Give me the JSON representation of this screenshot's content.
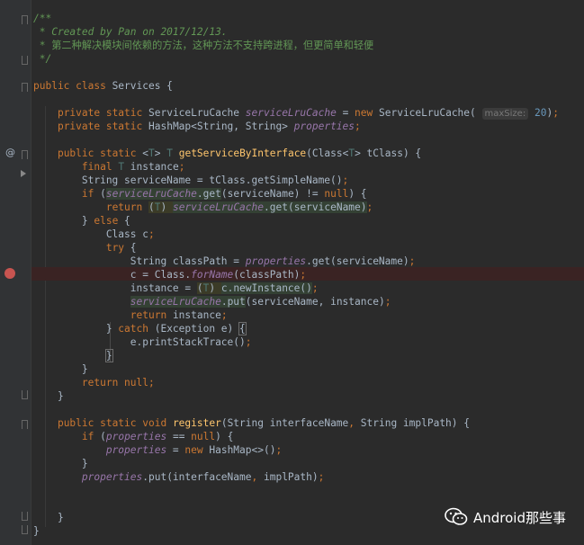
{
  "editor": {
    "lines": [
      [
        {
          "t": "/**",
          "c": "cm"
        }
      ],
      [
        {
          "t": " * Created by Pan on 2017/12/13.",
          "c": "cm"
        }
      ],
      [
        {
          "t": " * 第二种解决模块间依赖的方法，这种方法不支持跨进程，但更简单和轻便",
          "c": "cmcn"
        }
      ],
      [
        {
          "t": " */",
          "c": "cm"
        }
      ],
      [],
      [
        {
          "t": "public class ",
          "c": "kw"
        },
        {
          "t": "Services {"
        }
      ],
      [],
      [
        {
          "t": "    "
        },
        {
          "t": "private static ",
          "c": "kw"
        },
        {
          "t": "ServiceLruCache "
        },
        {
          "t": "serviceLruCache",
          "c": "fld"
        },
        {
          "t": " = "
        },
        {
          "t": "new ",
          "c": "kw"
        },
        {
          "t": "ServiceLruCache( "
        },
        {
          "t": "maxSize:",
          "c": "hint"
        },
        {
          "t": " "
        },
        {
          "t": "20",
          "c": "num"
        },
        {
          "t": ")"
        },
        {
          "t": ";",
          "c": "kw"
        }
      ],
      [
        {
          "t": "    "
        },
        {
          "t": "private static ",
          "c": "kw"
        },
        {
          "t": "HashMap<String, String> "
        },
        {
          "t": "properties",
          "c": "fld"
        },
        {
          "t": ";",
          "c": "kw"
        }
      ],
      [],
      [
        {
          "t": "    "
        },
        {
          "t": "public static ",
          "c": "kw"
        },
        {
          "t": "<"
        },
        {
          "t": "T",
          "c": "tp"
        },
        {
          "t": "> "
        },
        {
          "t": "T ",
          "c": "tp"
        },
        {
          "t": "getServiceByInterface",
          "c": "fn"
        },
        {
          "t": "(Class<"
        },
        {
          "t": "T",
          "c": "tp"
        },
        {
          "t": "> tClass) {"
        }
      ],
      [
        {
          "t": "        "
        },
        {
          "t": "final ",
          "c": "kw"
        },
        {
          "t": "T ",
          "c": "tp"
        },
        {
          "t": "instance"
        },
        {
          "t": ";",
          "c": "kw"
        }
      ],
      [
        {
          "t": "        String serviceName = tClass.getSimpleName()"
        },
        {
          "t": ";",
          "c": "kw"
        }
      ],
      [
        {
          "t": "        "
        },
        {
          "t": "if ",
          "c": "kw"
        },
        {
          "t": "("
        },
        {
          "t": "serviceLruCache",
          "c": "fld hl"
        },
        {
          "t": ".get",
          "c": "hl"
        },
        {
          "t": "(serviceName) != "
        },
        {
          "t": "null",
          "c": "kw"
        },
        {
          "t": ") {"
        }
      ],
      [
        {
          "t": "            "
        },
        {
          "t": "return ",
          "c": "kw"
        },
        {
          "t": "(",
          "c": "hlb"
        },
        {
          "t": "T",
          "c": "tp hlb"
        },
        {
          "t": ") ",
          "c": "hlb"
        },
        {
          "t": "serviceLruCache",
          "c": "fld hl"
        },
        {
          "t": ".get(serviceName)",
          "c": "hl"
        },
        {
          "t": ";",
          "c": "kw"
        }
      ],
      [
        {
          "t": "        } "
        },
        {
          "t": "else ",
          "c": "kw"
        },
        {
          "t": "{"
        }
      ],
      [
        {
          "t": "            Class c"
        },
        {
          "t": ";",
          "c": "kw"
        }
      ],
      [
        {
          "t": "            "
        },
        {
          "t": "try ",
          "c": "kw"
        },
        {
          "t": "{"
        }
      ],
      [
        {
          "t": "                String classPath = "
        },
        {
          "t": "properties",
          "c": "fld"
        },
        {
          "t": ".get(serviceName)"
        },
        {
          "t": ";",
          "c": "kw"
        }
      ],
      [
        {
          "t": "                c = Class."
        },
        {
          "t": "forName",
          "c": "fld"
        },
        {
          "t": "(classPath)"
        },
        {
          "t": ";",
          "c": "kw"
        }
      ],
      [
        {
          "t": "                instance = "
        },
        {
          "t": "(",
          "c": "hlb"
        },
        {
          "t": "T",
          "c": "tp hlb"
        },
        {
          "t": ") ",
          "c": "hlb"
        },
        {
          "t": "c.newInstance()",
          "c": "hl"
        },
        {
          "t": ";",
          "c": "kw"
        }
      ],
      [
        {
          "t": "                "
        },
        {
          "t": "serviceLruCache",
          "c": "fld hl"
        },
        {
          "t": ".put",
          "c": "hl"
        },
        {
          "t": "(serviceName, instance)"
        },
        {
          "t": ";",
          "c": "kw"
        }
      ],
      [
        {
          "t": "                "
        },
        {
          "t": "return ",
          "c": "kw"
        },
        {
          "t": "instance"
        },
        {
          "t": ";",
          "c": "kw"
        }
      ],
      [
        {
          "t": "            } "
        },
        {
          "t": "catch ",
          "c": "kw"
        },
        {
          "t": "(Exception e) "
        },
        {
          "t": "{",
          "c": "brk"
        }
      ],
      [
        {
          "t": "                e.printStackTrace()"
        },
        {
          "t": ";",
          "c": "kw"
        }
      ],
      [
        {
          "t": "            "
        },
        {
          "t": "}",
          "c": "brk"
        }
      ],
      [
        {
          "t": "        }"
        }
      ],
      [
        {
          "t": "        "
        },
        {
          "t": "return null",
          "c": "kw"
        },
        {
          "t": ";",
          "c": "kw"
        }
      ],
      [
        {
          "t": "    }"
        }
      ],
      [],
      [
        {
          "t": "    "
        },
        {
          "t": "public static void ",
          "c": "kw"
        },
        {
          "t": "register",
          "c": "fn"
        },
        {
          "t": "(String interfaceName"
        },
        {
          "t": ", ",
          "c": "kw"
        },
        {
          "t": "String implPath) {"
        }
      ],
      [
        {
          "t": "        "
        },
        {
          "t": "if ",
          "c": "kw"
        },
        {
          "t": "("
        },
        {
          "t": "properties",
          "c": "fld"
        },
        {
          "t": " == "
        },
        {
          "t": "null",
          "c": "kw"
        },
        {
          "t": ") {"
        }
      ],
      [
        {
          "t": "            "
        },
        {
          "t": "properties",
          "c": "fld"
        },
        {
          "t": " = "
        },
        {
          "t": "new ",
          "c": "kw"
        },
        {
          "t": "HashMap<>()"
        },
        {
          "t": ";",
          "c": "kw"
        }
      ],
      [
        {
          "t": "        }"
        }
      ],
      [
        {
          "t": "        "
        },
        {
          "t": "properties",
          "c": "fld"
        },
        {
          "t": ".put(interfaceName"
        },
        {
          "t": ", ",
          "c": "kw"
        },
        {
          "t": "implPath)"
        },
        {
          "t": ";",
          "c": "kw"
        }
      ],
      [],
      [],
      [
        {
          "t": "    }"
        }
      ],
      [
        {
          "t": "}"
        }
      ]
    ],
    "breakpoint_line": 19,
    "override_marker_line": 10
  },
  "gutter": {
    "override_icon": "@",
    "breakpoint_icon": "breakpoint-dot-icon",
    "colors": {
      "breakpoint": "#c75450",
      "background": "#2b2b2b",
      "gutter": "#313335"
    }
  },
  "watermark": {
    "icon": "wechat-icon",
    "text": "Android那些事"
  }
}
